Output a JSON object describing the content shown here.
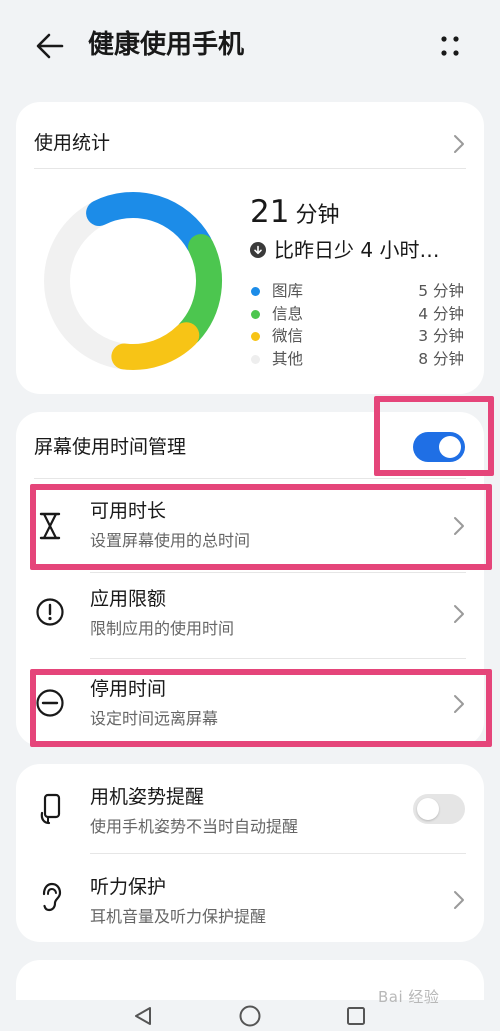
{
  "header": {
    "title": "健康使用手机",
    "back_icon": "arrow-left-icon",
    "more_icon": "more-dots-icon"
  },
  "stats": {
    "title": "使用统计",
    "total_value": "21",
    "total_unit": "分钟",
    "compare_text": "比昨日少 4 小时…",
    "legend": [
      {
        "name": "图库",
        "value": "5 分钟",
        "minutes": 5,
        "color": "#1c8ce8"
      },
      {
        "name": "信息",
        "value": "4 分钟",
        "minutes": 4,
        "color": "#4cc64f"
      },
      {
        "name": "微信",
        "value": "3 分钟",
        "minutes": 3,
        "color": "#f7c416"
      },
      {
        "name": "其他",
        "value": "8 分钟",
        "minutes": 8,
        "color": "#eeeeee"
      }
    ]
  },
  "screen_time": {
    "title": "屏幕使用时间管理",
    "enabled": true,
    "items": [
      {
        "title": "可用时长",
        "subtitle": "设置屏幕使用的总时间",
        "icon": "hourglass-icon"
      },
      {
        "title": "应用限额",
        "subtitle": "限制应用的使用时间",
        "icon": "alert-circle-icon"
      },
      {
        "title": "停用时间",
        "subtitle": "设定时间远离屏幕",
        "icon": "minus-circle-icon"
      }
    ]
  },
  "other": {
    "items": [
      {
        "title": "用机姿势提醒",
        "subtitle": "使用手机姿势不当时自动提醒",
        "icon": "phone-posture-icon",
        "toggle": false
      },
      {
        "title": "听力保护",
        "subtitle": "耳机音量及听力保护提醒",
        "icon": "ear-icon"
      }
    ]
  },
  "colors": {
    "accent": "#1f6fe5",
    "highlight": "#e5457a",
    "background": "#f1f3f5"
  },
  "watermark": "Bai 经验"
}
